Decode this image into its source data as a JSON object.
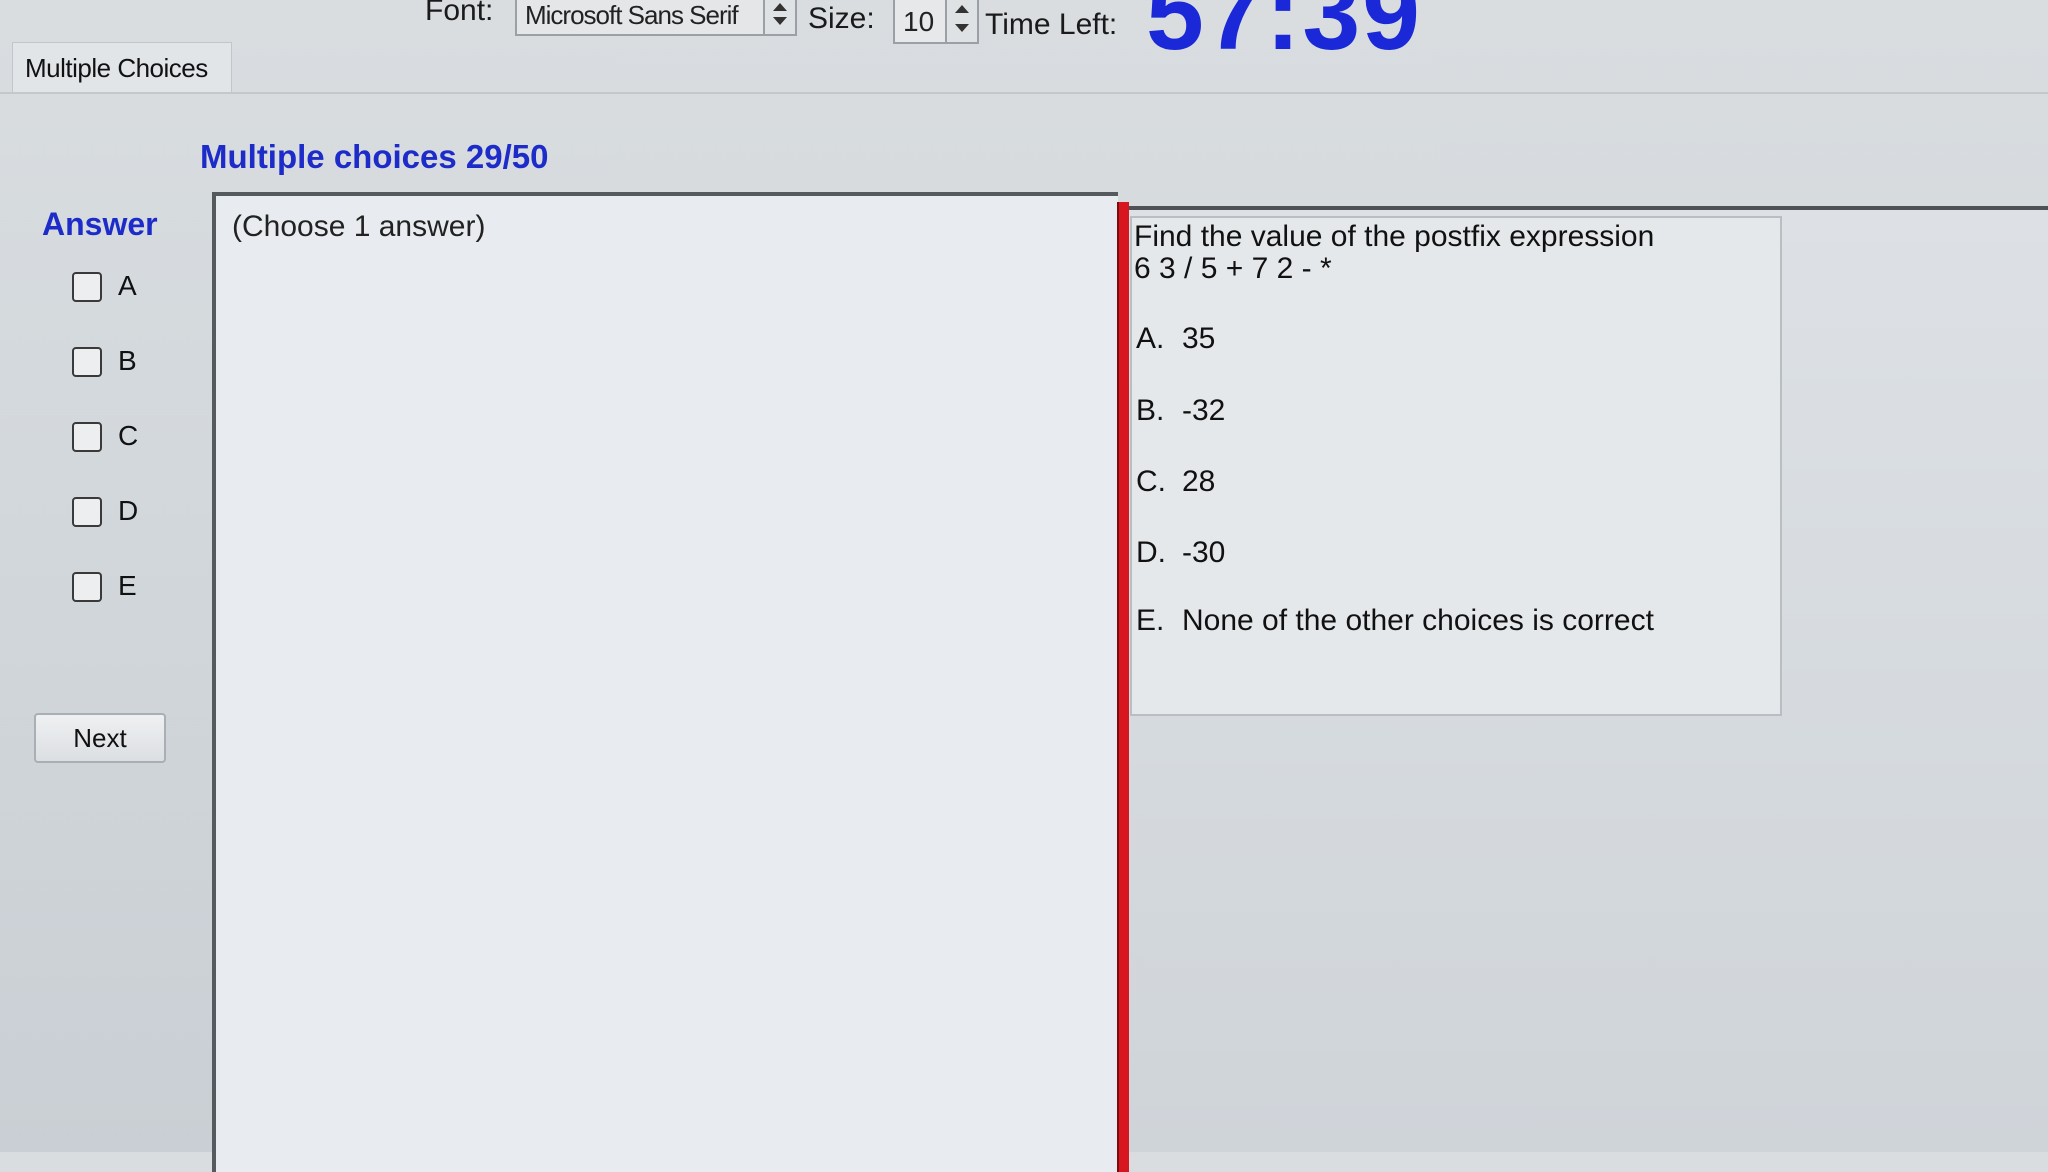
{
  "toolbar": {
    "font_label": "Font:",
    "font_value": "Microsoft Sans Serif",
    "size_label": "Size:",
    "size_value": "10",
    "time_label": "Time Left:",
    "time_value": "57:39"
  },
  "tab": {
    "label": "Multiple Choices"
  },
  "heading": "Multiple choices 29/50",
  "answer": {
    "title": "Answer",
    "options": [
      "A",
      "B",
      "C",
      "D",
      "E"
    ],
    "next_label": "Next"
  },
  "notes": {
    "instruction": "(Choose 1 answer)"
  },
  "question": {
    "line1": "Find the value of the postfix expression",
    "line2": "6 3 / 5 + 7 2 - *",
    "choices": [
      {
        "letter": "A.",
        "text": "35"
      },
      {
        "letter": "B.",
        "text": "-32"
      },
      {
        "letter": "C.",
        "text": "28"
      },
      {
        "letter": "D.",
        "text": "-30"
      },
      {
        "letter": "E.",
        "text": "None of the other choices is correct"
      }
    ]
  },
  "colors": {
    "accent_blue": "#1d2cc8",
    "timer_blue": "#1a28d8",
    "divider_red": "#d8161f"
  }
}
